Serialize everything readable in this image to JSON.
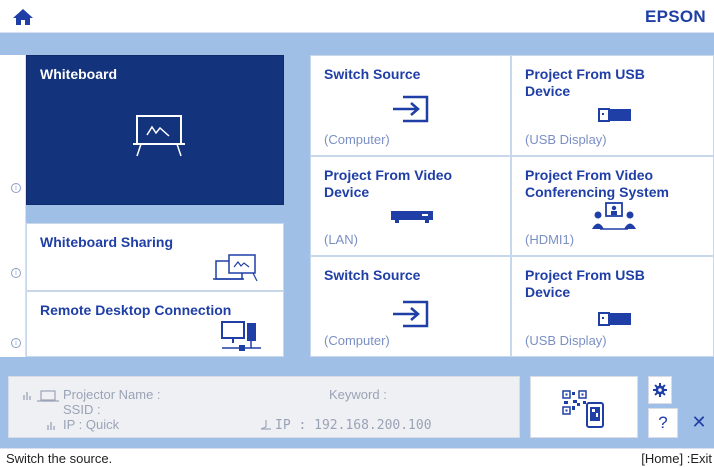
{
  "header": {
    "brand": "EPSON",
    "home_icon": "home-icon"
  },
  "tiles": {
    "whiteboard": {
      "title": "Whiteboard",
      "icon": "whiteboard-icon"
    },
    "whiteboard_sharing": {
      "title": "Whiteboard Sharing",
      "icon": "whiteboard-sharing-icon"
    },
    "remote_desktop": {
      "title": "Remote Desktop Connection",
      "icon": "remote-desktop-icon"
    },
    "switch_source_1": {
      "title": "Switch Source",
      "subtitle": "(Computer)",
      "icon": "input-icon"
    },
    "project_usb_1": {
      "title": "Project From USB Device",
      "subtitle": "(USB Display)",
      "icon": "usb-icon"
    },
    "project_video_device": {
      "title": "Project From Video Device",
      "subtitle": "(LAN)",
      "icon": "video-device-icon"
    },
    "project_video_conf": {
      "title": "Project From Video Conferencing System",
      "subtitle": "(HDMI1)",
      "icon": "conference-icon"
    },
    "switch_source_2": {
      "title": "Switch Source",
      "subtitle": "(Computer)",
      "icon": "input-icon"
    },
    "project_usb_2": {
      "title": "Project From USB Device",
      "subtitle": "(USB Display)",
      "icon": "usb-icon"
    }
  },
  "network": {
    "projector_name_label": "Projector Name :",
    "ssid_label": "SSID :",
    "ip_quick_label": "IP : Quick",
    "keyword_label": "Keyword :",
    "ip_label": "IP : 192.168.200.100"
  },
  "controls": {
    "help": "?",
    "close": "✕"
  },
  "status": {
    "message": "Switch the source.",
    "exit_hint": "[Home] :Exit"
  },
  "colors": {
    "accent": "#1f3fa6",
    "selected_tile": "#13337d",
    "background": "#9fbfe6"
  }
}
